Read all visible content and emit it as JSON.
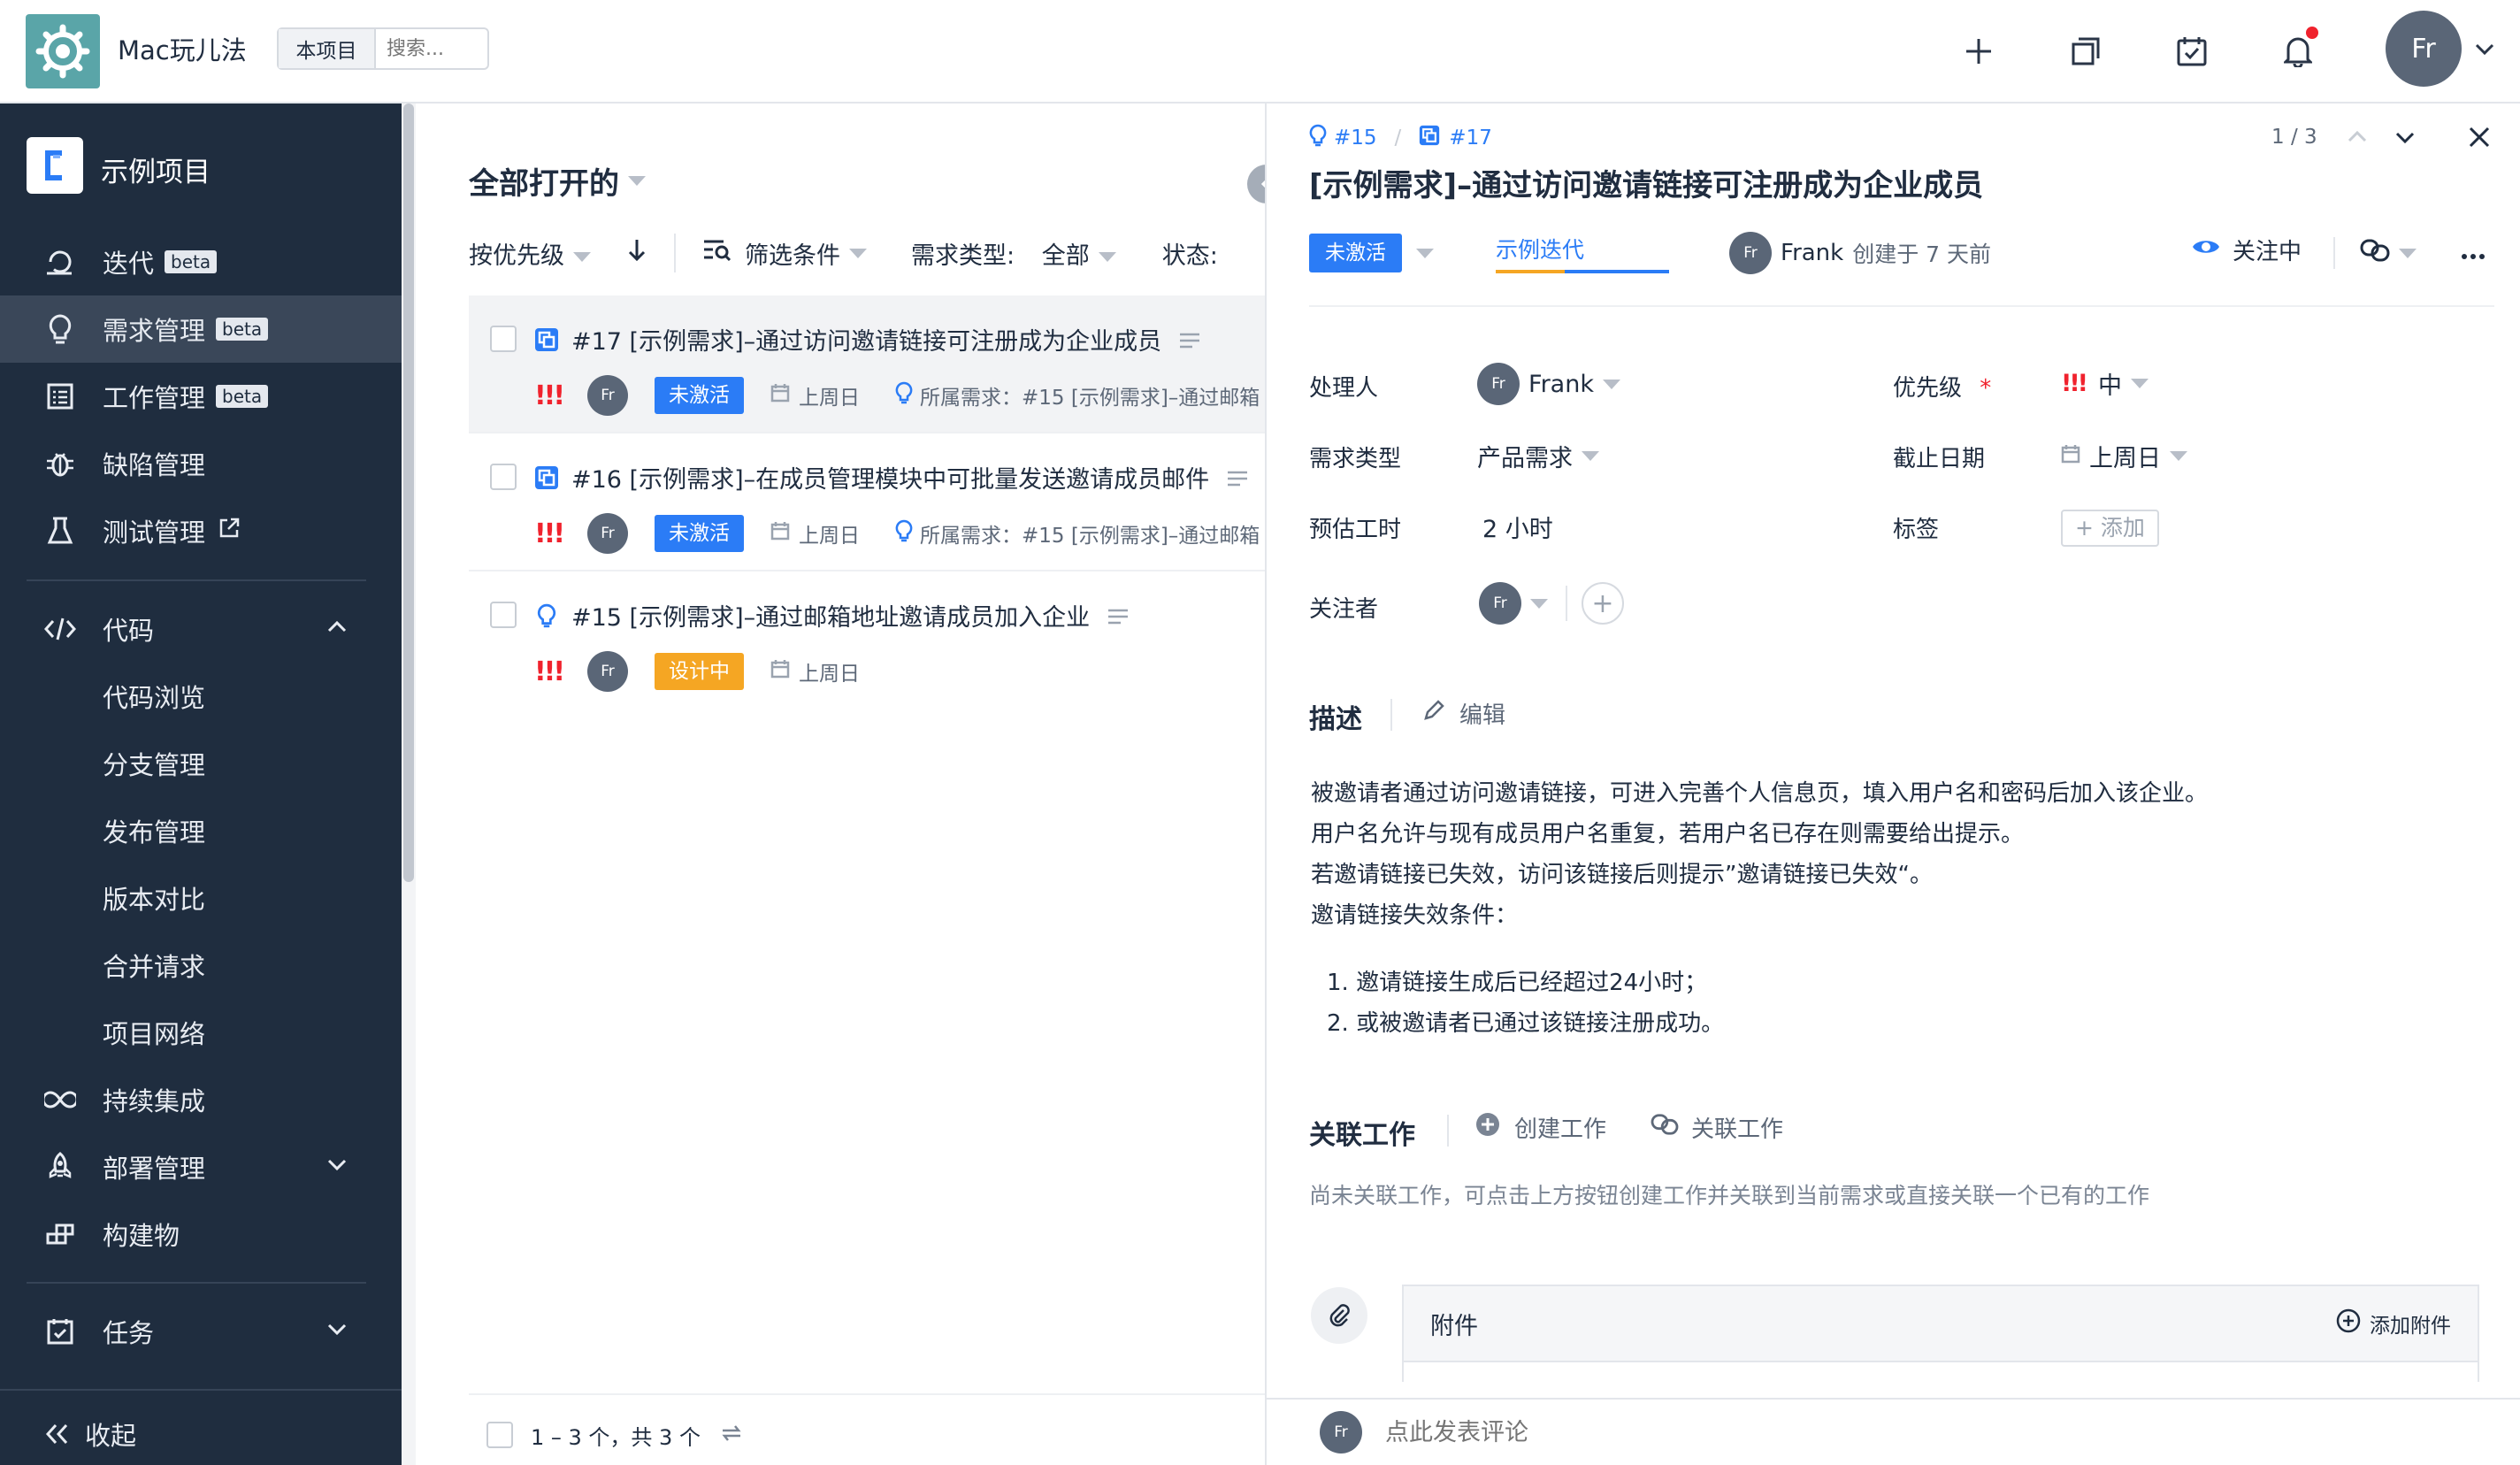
{
  "topbar": {
    "team_name": "Mac玩儿法",
    "search_scope": "本项目",
    "search_placeholder": "搜索...",
    "user_initials": "Fr"
  },
  "sidebar": {
    "project_name": "示例项目",
    "items": [
      {
        "label": "迭代",
        "badge": "beta",
        "icon": "iteration-icon"
      },
      {
        "label": "需求管理",
        "badge": "beta",
        "icon": "lightbulb-icon",
        "active": true
      },
      {
        "label": "工作管理",
        "badge": "beta",
        "icon": "worklist-icon"
      },
      {
        "label": "缺陷管理",
        "icon": "bug-icon"
      },
      {
        "label": "测试管理",
        "icon": "flask-icon",
        "external": true
      }
    ],
    "code_section": {
      "label": "代码",
      "sub_items": [
        "代码浏览",
        "分支管理",
        "发布管理",
        "版本对比",
        "合并请求",
        "项目网络"
      ]
    },
    "more_items": [
      {
        "label": "持续集成",
        "icon": "infinity-icon"
      },
      {
        "label": "部署管理",
        "icon": "rocket-icon"
      },
      {
        "label": "构建物",
        "icon": "artifact-icon"
      }
    ],
    "task_label": "任务",
    "collapse_label": "收起"
  },
  "list": {
    "title": "全部打开的",
    "sort_label": "按优先级",
    "filter_label": "筛选条件",
    "type_label": "需求类型:",
    "type_value": "全部",
    "status_label": "状态:",
    "rows": [
      {
        "title": "#17 [示例需求]–通过访问邀请链接可注册成为企业成员",
        "priority": "!!!",
        "avatar": "Fr",
        "status": "未激活",
        "due": "上周日",
        "parent": "所属需求：#15 [示例需求]–通过邮箱"
      },
      {
        "title": "#16 [示例需求]–在成员管理模块中可批量发送邀请成员邮件",
        "priority": "!!!",
        "avatar": "Fr",
        "status": "未激活",
        "due": "上周日",
        "parent": "所属需求：#15 [示例需求]–通过邮箱"
      },
      {
        "title": "#15 [示例需求]–通过邮箱地址邀请成员加入企业",
        "priority": "!!!",
        "avatar": "Fr",
        "status": "设计中",
        "due": "上周日"
      }
    ],
    "footer": "1 – 3 个，共 3 个"
  },
  "detail": {
    "crumb_parent": "#15",
    "crumb_current": "#17",
    "pager": "1 / 3",
    "title": "[示例需求]–通过访问邀请链接可注册成为企业成员",
    "status": "未激活",
    "iteration": "示例迭代",
    "creator_avatar": "Fr",
    "creator_name": "Frank",
    "created_text": "创建于 7 天前",
    "follow_label": "关注中",
    "fields": {
      "assignee_label": "处理人",
      "assignee_avatar": "Fr",
      "assignee_name": "Frank",
      "priority_label": "优先级",
      "priority_required": "*",
      "priority_marks": "!!!",
      "priority_value": "中",
      "type_label": "需求类型",
      "type_value": "产品需求",
      "deadline_label": "截止日期",
      "deadline_value": "上周日",
      "estimate_label": "预估工时",
      "estimate_value": "2 小时",
      "tags_label": "标签",
      "tags_add": "+ 添加",
      "watchers_label": "关注者",
      "watcher_avatar": "Fr"
    },
    "description": {
      "title": "描述",
      "edit": "编辑",
      "lines": [
        "被邀请者通过访问邀请链接，可进入完善个人信息页，填入用户名和密码后加入该企业。",
        "用户名允许与现有成员用户名重复，若用户名已存在则需要给出提示。",
        "若邀请链接已失效，访问该链接后则提示”邀请链接已失效“。",
        "邀请链接失效条件："
      ],
      "list": [
        "1.   邀请链接生成后已经超过24小时；",
        "2.   或被邀请者已通过该链接注册成功。"
      ]
    },
    "linked": {
      "title": "关联工作",
      "create": "创建工作",
      "link": "关联工作",
      "empty": "尚未关联工作，可点击上方按钮创建工作并关联到当前需求或直接关联一个已有的工作"
    },
    "attachments": {
      "label": "附件",
      "add": "添加附件"
    },
    "comment": {
      "avatar": "Fr",
      "placeholder": "点此发表评论"
    }
  },
  "colors": {
    "sidebar_bg": "#1f2d3f",
    "accent_blue": "#2b7cf6",
    "priority_red": "#f0222d",
    "status_orange": "#f5a623"
  }
}
